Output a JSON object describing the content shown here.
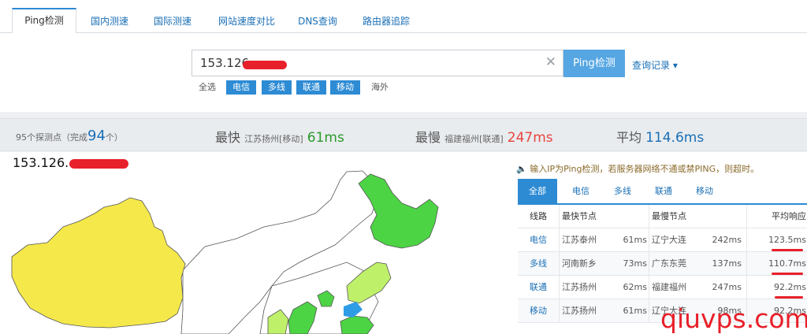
{
  "tabs": [
    {
      "label": "Ping检测",
      "active": true
    },
    {
      "label": "国内测速",
      "active": false
    },
    {
      "label": "国际测速",
      "active": false
    },
    {
      "label": "网站速度对比",
      "active": false
    },
    {
      "label": "DNS查询",
      "active": false
    },
    {
      "label": "路由器追踪",
      "active": false
    }
  ],
  "search": {
    "value": "153.126.",
    "ping_button": "Ping检测",
    "history_label": "查询记录 ▾",
    "clear_icon": "close-icon"
  },
  "filters": {
    "all": "全选",
    "telecom": "电信",
    "multiline": "多线",
    "unicom": "联通",
    "mobile": "移动",
    "overseas": "海外"
  },
  "stats": {
    "probe_prefix": "95个探测点（完成",
    "probe_done": "94",
    "probe_suffix": "个）",
    "fastest_label": "最快",
    "fastest_node": "江苏扬州[移动]",
    "fastest_value": "61ms",
    "slowest_label": "最慢",
    "slowest_node": "福建福州[联通]",
    "slowest_value": "247ms",
    "average_label": "平均",
    "average_value": "114.6ms"
  },
  "map": {
    "ip_title": "153.126.",
    "colors": {
      "slow": "#f5e84a",
      "fast": "#4cd444",
      "medium": "#bff06a",
      "none": "#ffffff",
      "sea": "#2f9ce6"
    }
  },
  "right": {
    "notice": "输入IP为Ping检测，若服务器网络不通或禁PING，则超时。",
    "tabs": [
      "全部",
      "电信",
      "多线",
      "联通",
      "移动"
    ],
    "headers": {
      "line": "线路",
      "fast": "最快节点",
      "slow": "最慢节点",
      "avg": "平均响应"
    },
    "rows": [
      {
        "line": "电信",
        "fast": "江苏泰州",
        "fast_ms": "61ms",
        "slow": "辽宁大连",
        "slow_ms": "242ms",
        "avg": "123.5ms"
      },
      {
        "line": "多线",
        "fast": "河南新乡",
        "fast_ms": "73ms",
        "slow": "广东东莞",
        "slow_ms": "137ms",
        "avg": "110.7ms"
      },
      {
        "line": "联通",
        "fast": "江苏扬州",
        "fast_ms": "62ms",
        "slow": "福建福州",
        "slow_ms": "247ms",
        "avg": "92.2ms"
      },
      {
        "line": "移动",
        "fast": "江苏扬州",
        "fast_ms": "61ms",
        "slow": "辽宁大连",
        "slow_ms": "98ms",
        "avg": "92.2ms"
      }
    ]
  },
  "watermark": "qiuvps.com",
  "accent": "#2d8bd4"
}
